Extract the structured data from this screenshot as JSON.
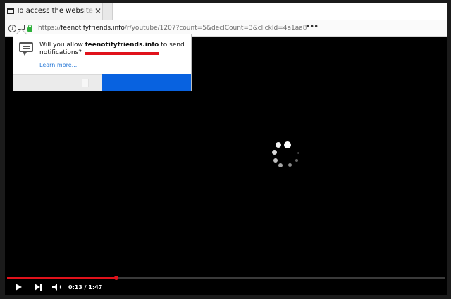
{
  "tab": {
    "title": "To access the website cl"
  },
  "address": {
    "scheme": "https://",
    "domain": "feenotifyfriends.info",
    "path": "/r/youtube/1207?count=5&declCount=3&clickId=4a1aa8"
  },
  "prompt": {
    "text_before": "Will you allow ",
    "domain": "feenotifyfriends.info",
    "text_after": " to send notifications?",
    "learn_more": "Learn more..."
  },
  "player": {
    "time": "0:13 / 1:47",
    "progress": 0.25
  },
  "colors": {
    "accent_red": "#e0121b",
    "allow_blue": "#0862e0",
    "lock_green": "#2db13b",
    "link_blue": "#2a7ad7"
  },
  "icons": [
    "page-icon",
    "close-icon",
    "info-icon",
    "notification-icon",
    "lock-icon",
    "more-icon",
    "loading-spinner-icon",
    "play-icon",
    "next-icon",
    "volume-icon"
  ]
}
